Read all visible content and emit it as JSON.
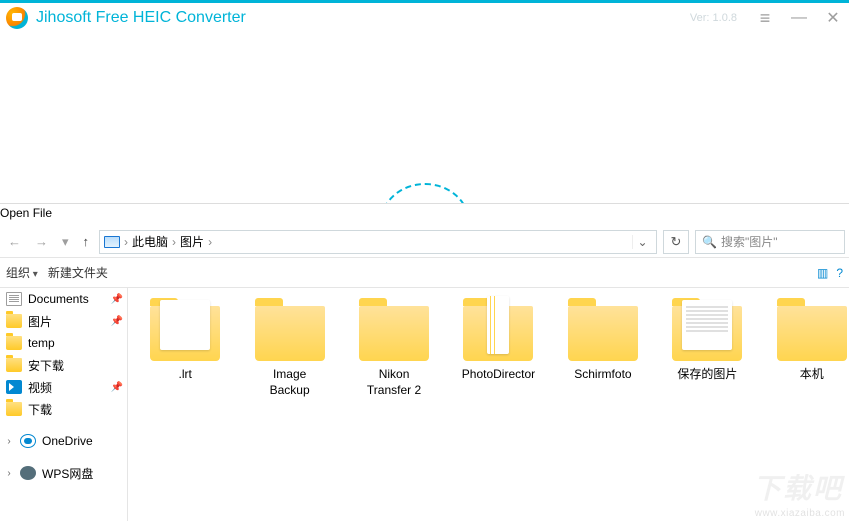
{
  "app": {
    "title": "Jihosoft Free HEIC Converter",
    "version": "Ver: 1.0.8"
  },
  "dialog": {
    "title": "Open File",
    "breadcrumb": {
      "root": "此电脑",
      "sub": "图片"
    },
    "search_placeholder": "搜索\"图片\"",
    "toolbar": {
      "organize": "组织",
      "new_folder": "新建文件夹"
    }
  },
  "sidebar": {
    "items": [
      {
        "label": "Documents",
        "icon": "doc",
        "pinned": true
      },
      {
        "label": "图片",
        "icon": "fld",
        "pinned": true
      },
      {
        "label": "temp",
        "icon": "fld",
        "pinned": false
      },
      {
        "label": "安下载",
        "icon": "fld",
        "pinned": false
      },
      {
        "label": "视频",
        "icon": "vid",
        "pinned": true
      },
      {
        "label": "下载",
        "icon": "fld2",
        "pinned": false
      }
    ],
    "groups": [
      {
        "label": "OneDrive",
        "icon": "cloud"
      },
      {
        "label": "WPS网盘",
        "icon": "disk"
      }
    ]
  },
  "files": [
    {
      "label": ".lrt",
      "variant": "paper"
    },
    {
      "label": "Image Backup",
      "variant": "plain"
    },
    {
      "label": "Nikon Transfer 2",
      "variant": "plain"
    },
    {
      "label": "PhotoDirector",
      "variant": "thin"
    },
    {
      "label": "Schirmfoto",
      "variant": "plain"
    },
    {
      "label": "保存的图片",
      "variant": "stack"
    },
    {
      "label": "本机",
      "variant": "plain"
    }
  ],
  "watermark": {
    "small": "www.xiazaiba.com",
    "big": "下载吧"
  }
}
